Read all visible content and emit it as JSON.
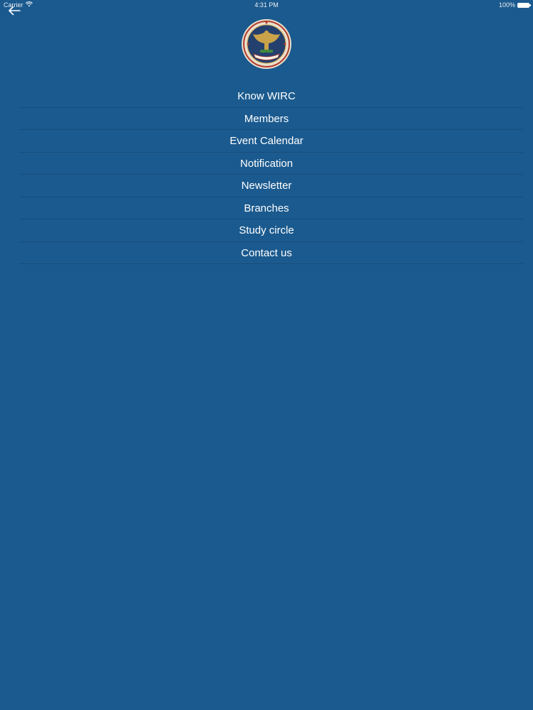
{
  "status_bar": {
    "carrier": "Carrier",
    "time": "4:31 PM",
    "battery": "100%"
  },
  "header": {
    "back_icon": "arrow-left-icon",
    "logo_icon": "institute-emblem-icon"
  },
  "menu": {
    "items": [
      {
        "label": "Know WIRC"
      },
      {
        "label": "Members"
      },
      {
        "label": "Event Calendar"
      },
      {
        "label": "Notification"
      },
      {
        "label": "Newsletter"
      },
      {
        "label": "Branches"
      },
      {
        "label": "Study circle"
      },
      {
        "label": "Contact us"
      }
    ]
  },
  "colors": {
    "background": "#1b5a8e",
    "text": "#ffffff"
  }
}
